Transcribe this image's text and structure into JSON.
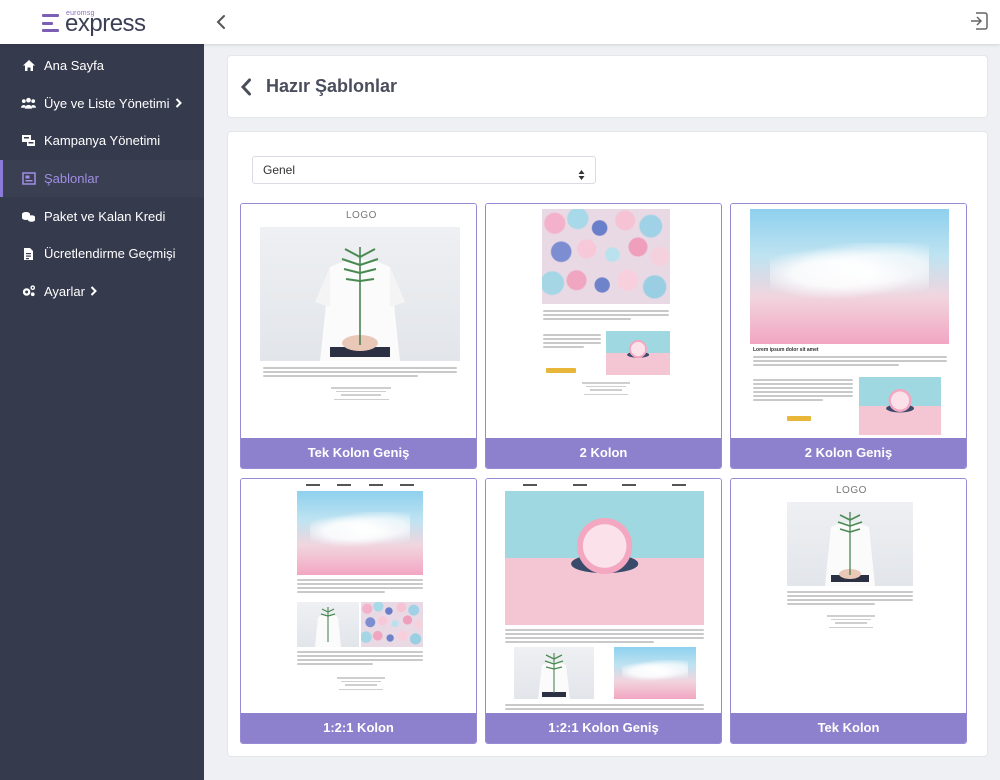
{
  "header": {
    "logo_small": "euromsg",
    "logo_big": "express"
  },
  "sidebar": {
    "items": [
      {
        "label": "Ana Sayfa"
      },
      {
        "label": "Üye ve Liste Yönetimi"
      },
      {
        "label": "Kampanya Yönetimi"
      },
      {
        "label": "Şablonlar"
      },
      {
        "label": "Paket ve Kalan Kredi"
      },
      {
        "label": "Ücretlendirme Geçmişi"
      },
      {
        "label": "Ayarlar"
      }
    ]
  },
  "page": {
    "title": "Hazır Şablonlar"
  },
  "filter": {
    "selected": "Genel"
  },
  "templates": [
    {
      "label": "Tek Kolon Geniş",
      "preview_logo": "LOGO"
    },
    {
      "label": "2 Kolon"
    },
    {
      "label": "2 Kolon Geniş",
      "heading": "Lorem ipsum dolor sit amet"
    },
    {
      "label": "1:2:1 Kolon"
    },
    {
      "label": "1:2:1 Kolon Geniş"
    },
    {
      "label": "Tek Kolon",
      "preview_logo": "LOGO"
    }
  ],
  "colors": {
    "sidebar": "#363a4d",
    "accent": "#8d80cc",
    "active_text": "#a08ee6"
  }
}
